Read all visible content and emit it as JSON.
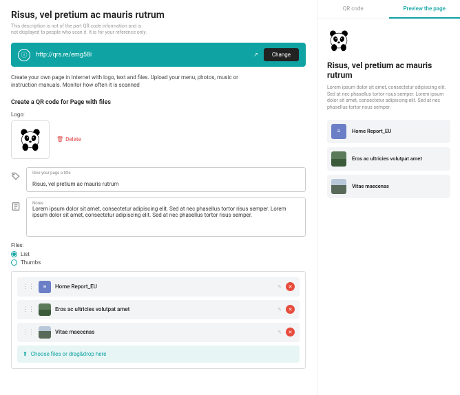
{
  "header": {
    "title": "Risus, vel pretium ac mauris rutrum",
    "subtitle": "This description is not of the part QR code information and is not displayed to people who scan it. It is for your reference only."
  },
  "urlbar": {
    "url": "http://qrs.re/emg58i",
    "change_label": "Change"
  },
  "helper": "Create your own page in Internet with logo, text and files. Upload your menu, photos, music or instruction manuals. Monitor how often it is scanned",
  "section_title": "Create a QR code for Page with files",
  "logo": {
    "label": "Logo:",
    "delete_label": "Delete"
  },
  "title_field": {
    "label": "Give your page a title",
    "value": "Risus, vel pretium ac mauris rutrum"
  },
  "notes_field": {
    "label": "Notes",
    "value": "Lorem ipsum dolor sit amet, consectetur adipiscing elit. Sed at nec phasellus tortor risus semper. Lorem ipsum dolor sit amet, consectetur adipiscing elit. Sed at nec phasellus tortor risus semper."
  },
  "files": {
    "label": "Files:",
    "options": {
      "list": "List",
      "thumbs": "Thumbs"
    },
    "items": [
      {
        "name": "Home Report_EU",
        "type": "doc"
      },
      {
        "name": "Eros ac ultricies volutpat amet",
        "type": "img1"
      },
      {
        "name": "Vitae maecenas",
        "type": "img2"
      }
    ],
    "dropzone": "Choose files or drag&drop here"
  },
  "tabs": {
    "qr": "QR code",
    "preview": "Preview the page"
  },
  "preview": {
    "title": "Risus, vel pretium ac mauris rutrum",
    "desc": "Lorem ipsum dolor sit amet, consectetur adipiscing elit. Sed at nec phasellus tortor risus semper. Lorem ipsum dolor sit amet, consectetur adipiscing elit. Sed at nec phasellus tortor risus semper."
  }
}
